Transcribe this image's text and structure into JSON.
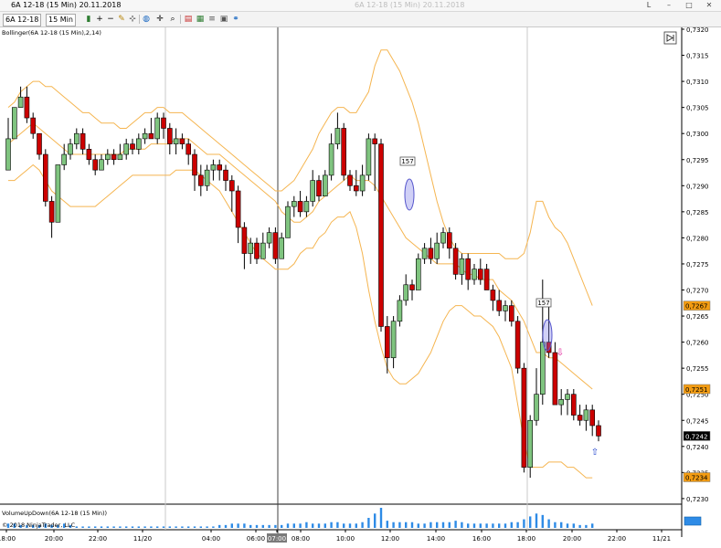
{
  "window": {
    "title": "6A 12-18 (15 Min)  20.11.2018",
    "ghost_text": "6A 12-18 (15 Min)  20.11.2018",
    "buttons": [
      "L",
      "–",
      "□",
      "✕"
    ]
  },
  "toolbar": {
    "instrument": "6A 12-18",
    "interval": "15 Min",
    "icons": [
      "bar-chart-icon",
      "zoom-in-icon",
      "zoom-out-icon",
      "pencil-icon",
      "drawing-tools-icon",
      "globe-icon",
      "crosshair-icon",
      "search-icon",
      "indicators-icon",
      "strategies-icon",
      "list-icon",
      "properties-icon",
      "link-icon"
    ]
  },
  "colors": {
    "bull": "#7fc47f",
    "bear": "#cc0000",
    "band": "#f5b550",
    "volume": "#2e8be6",
    "label_orange": "#f39c12"
  },
  "chart_data": [
    {
      "type": "candlestick",
      "indicator_label": "Bollinger(6A 12-18 (15 Min),2,14)",
      "ylim": [
        0.7226,
        0.7322
      ],
      "y_ticks": [
        "0,7230",
        "0,7235",
        "0,7240",
        "0,7245",
        "0,7250",
        "0,7255",
        "0,7260",
        "0,7265",
        "0,7270",
        "0,7275",
        "0,7280",
        "0,7285",
        "0,7290",
        "0,7295",
        "0,7300",
        "0,7305",
        "0,7310",
        "0,7315",
        "0,7320"
      ],
      "x_ticks": [
        "18:00",
        "20:00",
        "22:00",
        "11/20",
        "04:00",
        "06:00",
        "07:00",
        "08:00",
        "10:00",
        "12:00",
        "14:00",
        "16:00",
        "18:00",
        "20:00",
        "22:00",
        "11/21"
      ],
      "price_labels": {
        "upper_band": "0,7267",
        "last_price": "0,7242",
        "lower_band": "0,7234",
        "middle_band": "0,7251"
      },
      "annotations": [
        "157",
        "157"
      ],
      "candles": [
        [
          0.7293,
          0.7299,
          0.7296,
          0.7303
        ],
        [
          0.7299,
          0.7305,
          0.7299,
          0.7305
        ],
        [
          0.7305,
          0.7307,
          0.7305,
          0.7309
        ],
        [
          0.7307,
          0.7303,
          0.7302,
          0.7309
        ],
        [
          0.7303,
          0.73,
          0.7299,
          0.7304
        ],
        [
          0.73,
          0.7296,
          0.7295,
          0.73
        ],
        [
          0.7296,
          0.7287,
          0.7286,
          0.7297
        ],
        [
          0.7287,
          0.7283,
          0.728,
          0.7288
        ],
        [
          0.7283,
          0.7294,
          0.7283,
          0.7294
        ],
        [
          0.7294,
          0.7296,
          0.7293,
          0.7298
        ],
        [
          0.7296,
          0.7298,
          0.7295,
          0.7299
        ],
        [
          0.7298,
          0.73,
          0.7297,
          0.7301
        ],
        [
          0.73,
          0.7297,
          0.7296,
          0.7301
        ],
        [
          0.7297,
          0.7295,
          0.7294,
          0.7298
        ],
        [
          0.7295,
          0.7293,
          0.7292,
          0.7296
        ],
        [
          0.7293,
          0.7295,
          0.7293,
          0.7296
        ],
        [
          0.7295,
          0.7296,
          0.7294,
          0.7297
        ],
        [
          0.7296,
          0.7295,
          0.7294,
          0.7297
        ],
        [
          0.7295,
          0.7296,
          0.7295,
          0.7298
        ],
        [
          0.7296,
          0.7298,
          0.7295,
          0.7299
        ],
        [
          0.7298,
          0.7297,
          0.7296,
          0.7299
        ],
        [
          0.7297,
          0.7299,
          0.7296,
          0.73
        ],
        [
          0.7299,
          0.73,
          0.7298,
          0.7301
        ],
        [
          0.73,
          0.7299,
          0.7299,
          0.7303
        ],
        [
          0.7299,
          0.7303,
          0.7298,
          0.7304
        ],
        [
          0.7303,
          0.7301,
          0.7299,
          0.7304
        ],
        [
          0.7301,
          0.7298,
          0.7296,
          0.7302
        ],
        [
          0.7298,
          0.7299,
          0.7296,
          0.7301
        ],
        [
          0.7299,
          0.7298,
          0.7297,
          0.73
        ],
        [
          0.7298,
          0.7296,
          0.7294,
          0.7299
        ],
        [
          0.7296,
          0.7292,
          0.7289,
          0.7297
        ],
        [
          0.7292,
          0.729,
          0.7288,
          0.7294
        ],
        [
          0.729,
          0.7293,
          0.7289,
          0.7294
        ],
        [
          0.7293,
          0.7294,
          0.7291,
          0.7295
        ],
        [
          0.7294,
          0.7293,
          0.7291,
          0.7295
        ],
        [
          0.7293,
          0.7291,
          0.7289,
          0.7294
        ],
        [
          0.7291,
          0.7289,
          0.7285,
          0.7292
        ],
        [
          0.7289,
          0.7282,
          0.7279,
          0.729
        ],
        [
          0.7282,
          0.7277,
          0.7274,
          0.7283
        ],
        [
          0.7277,
          0.7279,
          0.7275,
          0.728
        ],
        [
          0.7279,
          0.7276,
          0.7275,
          0.728
        ],
        [
          0.7276,
          0.7279,
          0.7276,
          0.7281
        ],
        [
          0.7279,
          0.7281,
          0.7278,
          0.7282
        ],
        [
          0.7281,
          0.7276,
          0.7275,
          0.7282
        ],
        [
          0.7276,
          0.728,
          0.7276,
          0.7281
        ],
        [
          0.728,
          0.7286,
          0.728,
          0.7287
        ],
        [
          0.7286,
          0.7287,
          0.7284,
          0.7288
        ],
        [
          0.7287,
          0.7285,
          0.7284,
          0.7289
        ],
        [
          0.7285,
          0.7287,
          0.7284,
          0.7288
        ],
        [
          0.7287,
          0.7291,
          0.7286,
          0.7293
        ],
        [
          0.7291,
          0.7288,
          0.7287,
          0.7292
        ],
        [
          0.7288,
          0.7292,
          0.7288,
          0.7293
        ],
        [
          0.7292,
          0.7298,
          0.7291,
          0.73
        ],
        [
          0.7298,
          0.7301,
          0.7297,
          0.7304
        ],
        [
          0.7301,
          0.7292,
          0.7291,
          0.7302
        ],
        [
          0.7292,
          0.729,
          0.7289,
          0.7293
        ],
        [
          0.729,
          0.7289,
          0.7288,
          0.7293
        ],
        [
          0.7289,
          0.7292,
          0.7288,
          0.7294
        ],
        [
          0.7292,
          0.7299,
          0.7291,
          0.73
        ],
        [
          0.7299,
          0.7298,
          0.7289,
          0.73
        ],
        [
          0.7298,
          0.7263,
          0.7262,
          0.7299
        ],
        [
          0.7263,
          0.7257,
          0.7254,
          0.7265
        ],
        [
          0.7257,
          0.7264,
          0.7255,
          0.7265
        ],
        [
          0.7264,
          0.7268,
          0.7263,
          0.7269
        ],
        [
          0.7268,
          0.7271,
          0.7267,
          0.7273
        ],
        [
          0.7271,
          0.727,
          0.7268,
          0.7272
        ],
        [
          0.727,
          0.7276,
          0.727,
          0.7277
        ],
        [
          0.7276,
          0.7278,
          0.7275,
          0.7279
        ],
        [
          0.7278,
          0.7276,
          0.7275,
          0.728
        ],
        [
          0.7276,
          0.7279,
          0.7275,
          0.7281
        ],
        [
          0.7279,
          0.7281,
          0.7278,
          0.7282
        ],
        [
          0.7281,
          0.7278,
          0.7276,
          0.7282
        ],
        [
          0.7278,
          0.7273,
          0.7272,
          0.7279
        ],
        [
          0.7273,
          0.7276,
          0.7271,
          0.7277
        ],
        [
          0.7276,
          0.7272,
          0.727,
          0.7277
        ],
        [
          0.7272,
          0.7274,
          0.7271,
          0.7275
        ],
        [
          0.7274,
          0.7272,
          0.7271,
          0.7276
        ],
        [
          0.7274,
          0.727,
          0.727,
          0.7275
        ],
        [
          0.727,
          0.7268,
          0.7266,
          0.7271
        ],
        [
          0.7268,
          0.7266,
          0.7265,
          0.727
        ],
        [
          0.7266,
          0.7267,
          0.7264,
          0.7268
        ],
        [
          0.7267,
          0.7264,
          0.7263,
          0.7268
        ],
        [
          0.7264,
          0.7255,
          0.7254,
          0.7265
        ],
        [
          0.7255,
          0.7236,
          0.7235,
          0.7256
        ],
        [
          0.7236,
          0.7245,
          0.7234,
          0.7246
        ],
        [
          0.7245,
          0.725,
          0.7244,
          0.7255
        ],
        [
          0.725,
          0.726,
          0.7248,
          0.7272
        ],
        [
          0.726,
          0.7258,
          0.7257,
          0.7267
        ],
        [
          0.7258,
          0.7248,
          0.7248,
          0.726
        ],
        [
          0.7248,
          0.7249,
          0.7246,
          0.7251
        ],
        [
          0.7249,
          0.725,
          0.7246,
          0.7251
        ],
        [
          0.725,
          0.7246,
          0.7245,
          0.7251
        ],
        [
          0.7246,
          0.7245,
          0.7244,
          0.7248
        ],
        [
          0.7245,
          0.7247,
          0.7243,
          0.7248
        ],
        [
          0.7247,
          0.7244,
          0.7242,
          0.7248
        ],
        [
          0.7244,
          0.7242,
          0.7241,
          0.7245
        ]
      ],
      "bollinger": {
        "upper": [
          0.7305,
          0.7306,
          0.7308,
          0.7309,
          0.731,
          0.731,
          0.7309,
          0.7309,
          0.7308,
          0.7307,
          0.7306,
          0.7305,
          0.7304,
          0.7304,
          0.7303,
          0.7302,
          0.7302,
          0.7302,
          0.7301,
          0.7301,
          0.7302,
          0.7303,
          0.7304,
          0.7304,
          0.7305,
          0.7305,
          0.7304,
          0.7304,
          0.7304,
          0.7303,
          0.7302,
          0.7301,
          0.73,
          0.7299,
          0.7298,
          0.7297,
          0.7296,
          0.7295,
          0.7294,
          0.7293,
          0.7292,
          0.7291,
          0.729,
          0.7289,
          0.7289,
          0.729,
          0.7291,
          0.7293,
          0.7295,
          0.7297,
          0.73,
          0.7302,
          0.7304,
          0.7305,
          0.7305,
          0.7304,
          0.7304,
          0.7306,
          0.7308,
          0.7313,
          0.7316,
          0.7316,
          0.7314,
          0.7312,
          0.7309,
          0.7306,
          0.7302,
          0.7297,
          0.7292,
          0.7287,
          0.7283,
          0.728,
          0.7278,
          0.7277,
          0.7277,
          0.7277,
          0.7277,
          0.7277,
          0.7277,
          0.7277,
          0.7276,
          0.7276,
          0.7276,
          0.7277,
          0.7281,
          0.7287,
          0.7287,
          0.7284,
          0.7282,
          0.7281,
          0.7279,
          0.7276,
          0.7273,
          0.727,
          0.7267
        ],
        "middle": [
          0.7298,
          0.7299,
          0.73,
          0.7301,
          0.7302,
          0.7301,
          0.73,
          0.7299,
          0.7298,
          0.7297,
          0.7296,
          0.7296,
          0.7296,
          0.7296,
          0.7296,
          0.7296,
          0.7296,
          0.7296,
          0.7296,
          0.7297,
          0.7297,
          0.7297,
          0.7297,
          0.7298,
          0.7298,
          0.7298,
          0.7298,
          0.7299,
          0.7299,
          0.7299,
          0.7298,
          0.7297,
          0.7296,
          0.7296,
          0.7296,
          0.7295,
          0.7294,
          0.7293,
          0.7292,
          0.7291,
          0.729,
          0.7289,
          0.7288,
          0.7287,
          0.7285,
          0.7284,
          0.7283,
          0.7283,
          0.7284,
          0.7285,
          0.7287,
          0.7288,
          0.7289,
          0.729,
          0.7291,
          0.7292,
          0.7291,
          0.7291,
          0.7291,
          0.729,
          0.7288,
          0.7286,
          0.7284,
          0.7282,
          0.728,
          0.7279,
          0.7278,
          0.7277,
          0.7276,
          0.7275,
          0.7275,
          0.7275,
          0.7275,
          0.7274,
          0.7273,
          0.7273,
          0.7272,
          0.7272,
          0.7272,
          0.727,
          0.7269,
          0.7268,
          0.7266,
          0.7264,
          0.7261,
          0.7258,
          0.7258,
          0.7257,
          0.7257,
          0.7256,
          0.7255,
          0.7254,
          0.7253,
          0.7252,
          0.7251
        ],
        "lower": [
          0.7291,
          0.7291,
          0.7292,
          0.7293,
          0.7294,
          0.7293,
          0.7291,
          0.7289,
          0.7288,
          0.7287,
          0.7286,
          0.7286,
          0.7286,
          0.7286,
          0.7286,
          0.7287,
          0.7288,
          0.7289,
          0.729,
          0.7291,
          0.7292,
          0.7292,
          0.7292,
          0.7292,
          0.7292,
          0.7292,
          0.7292,
          0.7293,
          0.7293,
          0.7293,
          0.7293,
          0.7292,
          0.7291,
          0.729,
          0.7289,
          0.7287,
          0.7285,
          0.7283,
          0.7281,
          0.7279,
          0.7277,
          0.7276,
          0.7275,
          0.7274,
          0.7274,
          0.7274,
          0.7275,
          0.7277,
          0.7278,
          0.7278,
          0.728,
          0.7281,
          0.7283,
          0.7284,
          0.7284,
          0.7285,
          0.7282,
          0.7277,
          0.727,
          0.7264,
          0.7259,
          0.7255,
          0.7253,
          0.7252,
          0.7252,
          0.7253,
          0.7254,
          0.7256,
          0.7258,
          0.7261,
          0.7264,
          0.7266,
          0.7267,
          0.7267,
          0.7266,
          0.7265,
          0.7265,
          0.7264,
          0.7263,
          0.7261,
          0.7258,
          0.7255,
          0.7248,
          0.7241,
          0.7236,
          0.7236,
          0.7236,
          0.7237,
          0.7237,
          0.7237,
          0.7236,
          0.7236,
          0.7235,
          0.7234,
          0.7234
        ]
      }
    },
    {
      "type": "bar",
      "indicator_label": "VolumeUpDown(6A 12-18 (15 Min))",
      "copyright": "© 2018 NinjaTrader, LLC",
      "volumes": [
        3,
        3,
        2,
        2,
        2,
        2,
        3,
        2,
        2,
        3,
        2,
        1,
        1,
        1,
        1,
        1,
        1,
        1,
        1,
        1,
        1,
        1,
        1,
        1,
        1,
        1,
        1,
        1,
        1,
        1,
        1,
        1,
        1,
        1,
        2,
        2,
        3,
        3,
        3,
        2,
        2,
        2,
        2,
        2,
        2,
        3,
        3,
        3,
        4,
        3,
        3,
        3,
        4,
        4,
        3,
        3,
        3,
        4,
        7,
        10,
        14,
        5,
        4,
        4,
        4,
        4,
        3,
        3,
        4,
        4,
        4,
        4,
        5,
        4,
        3,
        3,
        3,
        3,
        3,
        3,
        3,
        4,
        4,
        6,
        8,
        10,
        9,
        6,
        4,
        4,
        3,
        3,
        2,
        2,
        3
      ],
      "last_up_marker": true
    }
  ]
}
